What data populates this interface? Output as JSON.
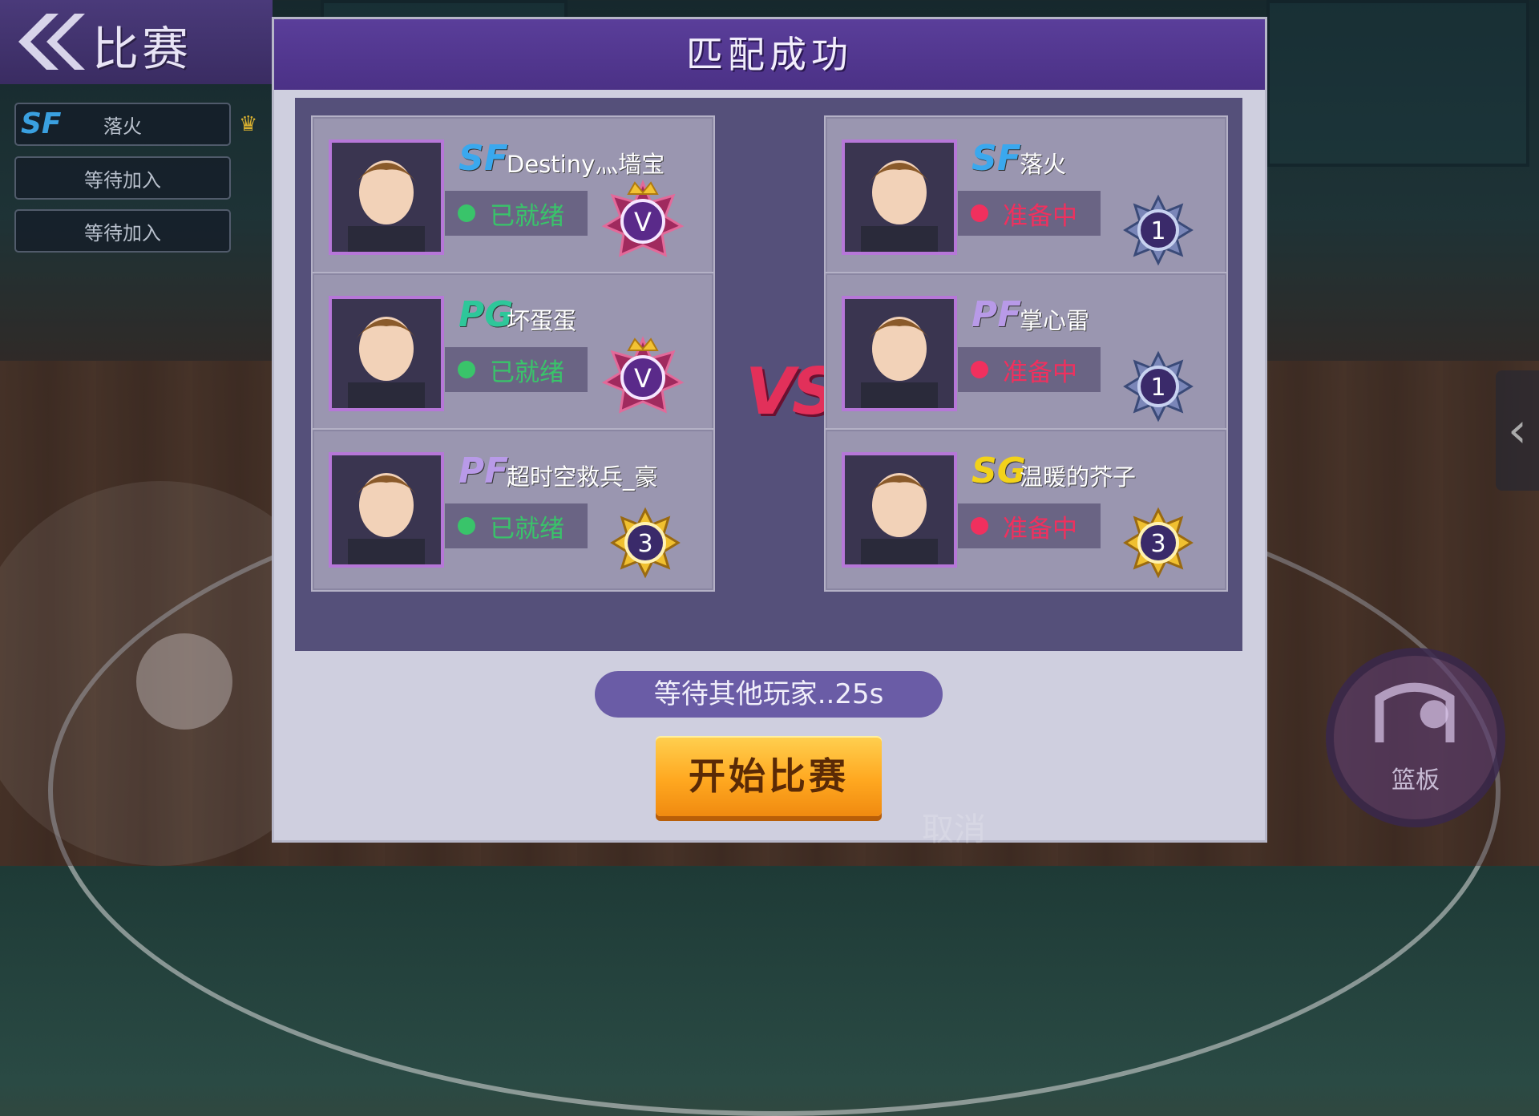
{
  "topbar": {
    "back_title": "比赛"
  },
  "side_slots": [
    {
      "position": "SF",
      "name": "落火"
    },
    {
      "position": "",
      "name": "等待加入"
    },
    {
      "position": "",
      "name": "等待加入"
    }
  ],
  "dialog": {
    "title": "匹配成功",
    "vs": "VS"
  },
  "team_left": [
    {
      "position": "SF",
      "pos_color": "#3aa8ee",
      "name": "Destiny灬墙宝",
      "status": "已就绪",
      "status_color": "#39c46a",
      "badge": "V",
      "badge_type": "crown"
    },
    {
      "position": "PG",
      "pos_color": "#2ec79a",
      "name": "坏蛋蛋",
      "status": "已就绪",
      "status_color": "#39c46a",
      "badge": "V",
      "badge_type": "crown"
    },
    {
      "position": "PF",
      "pos_color": "#b89ae8",
      "name": "超时空救兵_豪",
      "status": "已就绪",
      "status_color": "#39c46a",
      "badge": "3",
      "badge_type": "gold"
    }
  ],
  "team_right": [
    {
      "position": "SF",
      "pos_color": "#3aa8ee",
      "name": "落火",
      "status": "准备中",
      "status_color": "#f0305e",
      "badge": "1",
      "badge_type": "silver"
    },
    {
      "position": "PF",
      "pos_color": "#b89ae8",
      "name": "掌心雷",
      "status": "准备中",
      "status_color": "#f0305e",
      "badge": "1",
      "badge_type": "silver"
    },
    {
      "position": "SG",
      "pos_color": "#f2d21a",
      "name": "温暖的芥子",
      "status": "准备中",
      "status_color": "#f0305e",
      "badge": "3",
      "badge_type": "gold"
    }
  ],
  "waiting_text": "等待其他玩家..25s",
  "start_button": "开始比赛",
  "cancel_hint": "取消",
  "rebound_label": "篮板"
}
